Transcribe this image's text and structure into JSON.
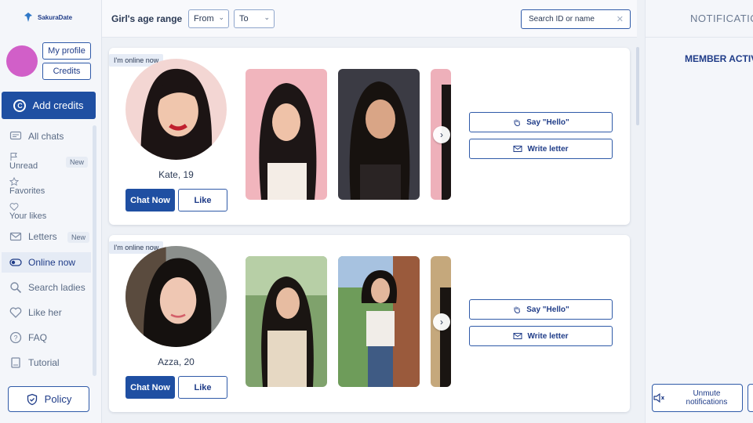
{
  "app": {
    "logo_text": "SakuraDate"
  },
  "sidebar": {
    "my_profile": "My profile",
    "credits": "Credits",
    "add_credits": "Add credits",
    "items": [
      {
        "label": "All chats",
        "icon": "chat-icon"
      },
      {
        "label": "Unread",
        "icon": "flag-icon",
        "badge": "New"
      },
      {
        "label": "Favorites",
        "icon": "star-icon"
      },
      {
        "label": "Your likes",
        "icon": "heart-icon"
      },
      {
        "label": "Letters",
        "icon": "envelope-icon",
        "badge": "New"
      },
      {
        "label": "Online now",
        "icon": "toggle-icon"
      },
      {
        "label": "Search ladies",
        "icon": "search-icon"
      },
      {
        "label": "Like her",
        "icon": "heart-icon"
      },
      {
        "label": "FAQ",
        "icon": "question-icon"
      },
      {
        "label": "Tutorial",
        "icon": "book-icon"
      }
    ],
    "policy": "Policy"
  },
  "topbar": {
    "age_label": "Girl's age range",
    "from": "From",
    "to": "To",
    "search_placeholder": "Search ID or name"
  },
  "profiles": [
    {
      "online": "I'm online now",
      "name": "Kate, 19",
      "chat_now": "Chat Now",
      "like": "Like",
      "say_hello": "Say \"Hello\"",
      "write_letter": "Write letter"
    },
    {
      "online": "I'm online now",
      "name": "Azza, 20",
      "chat_now": "Chat Now",
      "like": "Like",
      "say_hello": "Say \"Hello\"",
      "write_letter": "Write letter"
    }
  ],
  "rightpanel": {
    "title": "NOTIFICATION",
    "member_activity": "MEMBER ACTIV",
    "unmute": "Unmute notifications"
  },
  "colors": {
    "accent": "#1f4fa2",
    "avatar": "#d15fc8"
  }
}
